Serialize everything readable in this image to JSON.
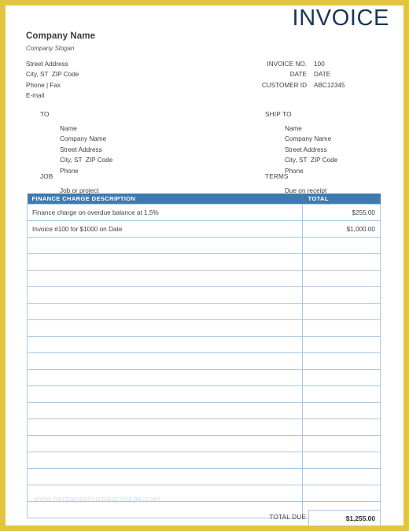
{
  "colors": {
    "page_border": "#e3c43e",
    "table_header_bg": "#3d7ab0",
    "table_grid": "#a9c8e0",
    "title_text": "#1d3557",
    "watermark": "#cfe0ef"
  },
  "header": {
    "title": "INVOICE",
    "company_name": "Company Name",
    "company_slogan": "Company Slogan",
    "company_lines": [
      "Street Address",
      "City, ST  ZIP Code",
      "Phone | Fax",
      "E-mail"
    ],
    "meta": [
      {
        "label": "INVOICE NO.",
        "value": "100"
      },
      {
        "label": "DATE",
        "value": "DATE"
      },
      {
        "label": "CUSTOMER ID",
        "value": "ABC12345"
      }
    ]
  },
  "bill_to": {
    "heading": "TO",
    "lines": [
      "Name",
      "Company Name",
      "Street Address",
      "City, ST  ZIP Code",
      "Phone"
    ]
  },
  "ship_to": {
    "heading": "SHIP TO",
    "lines": [
      "Name",
      "Company Name",
      "Street Address",
      "City, ST  ZIP Code",
      "Phone"
    ]
  },
  "job": {
    "heading": "JOB",
    "value": "Job or project"
  },
  "terms": {
    "heading": "TERMS",
    "value": "Due on receipt"
  },
  "table": {
    "columns": [
      "FINANCE CHARGE DESCRIPTION",
      "TOTAL"
    ],
    "rows": [
      {
        "description": "Finance charge on overdue balance at 1.5%",
        "total": "$255.00"
      },
      {
        "description": "Invoice #100 for $1000 on Date",
        "total": "$1,000.00"
      },
      {
        "description": "",
        "total": ""
      },
      {
        "description": "",
        "total": ""
      },
      {
        "description": "",
        "total": ""
      },
      {
        "description": "",
        "total": ""
      },
      {
        "description": "",
        "total": ""
      },
      {
        "description": "",
        "total": ""
      },
      {
        "description": "",
        "total": ""
      },
      {
        "description": "",
        "total": ""
      },
      {
        "description": "",
        "total": ""
      },
      {
        "description": "",
        "total": ""
      },
      {
        "description": "",
        "total": ""
      },
      {
        "description": "",
        "total": ""
      },
      {
        "description": "",
        "total": ""
      },
      {
        "description": "",
        "total": ""
      },
      {
        "description": "",
        "total": ""
      },
      {
        "description": "",
        "total": ""
      },
      {
        "description": "",
        "total": ""
      }
    ]
  },
  "watermark": "www.heritagechristiancollege.com",
  "total_due": {
    "label": "TOTAL DUE",
    "value": "$1,255.00"
  }
}
